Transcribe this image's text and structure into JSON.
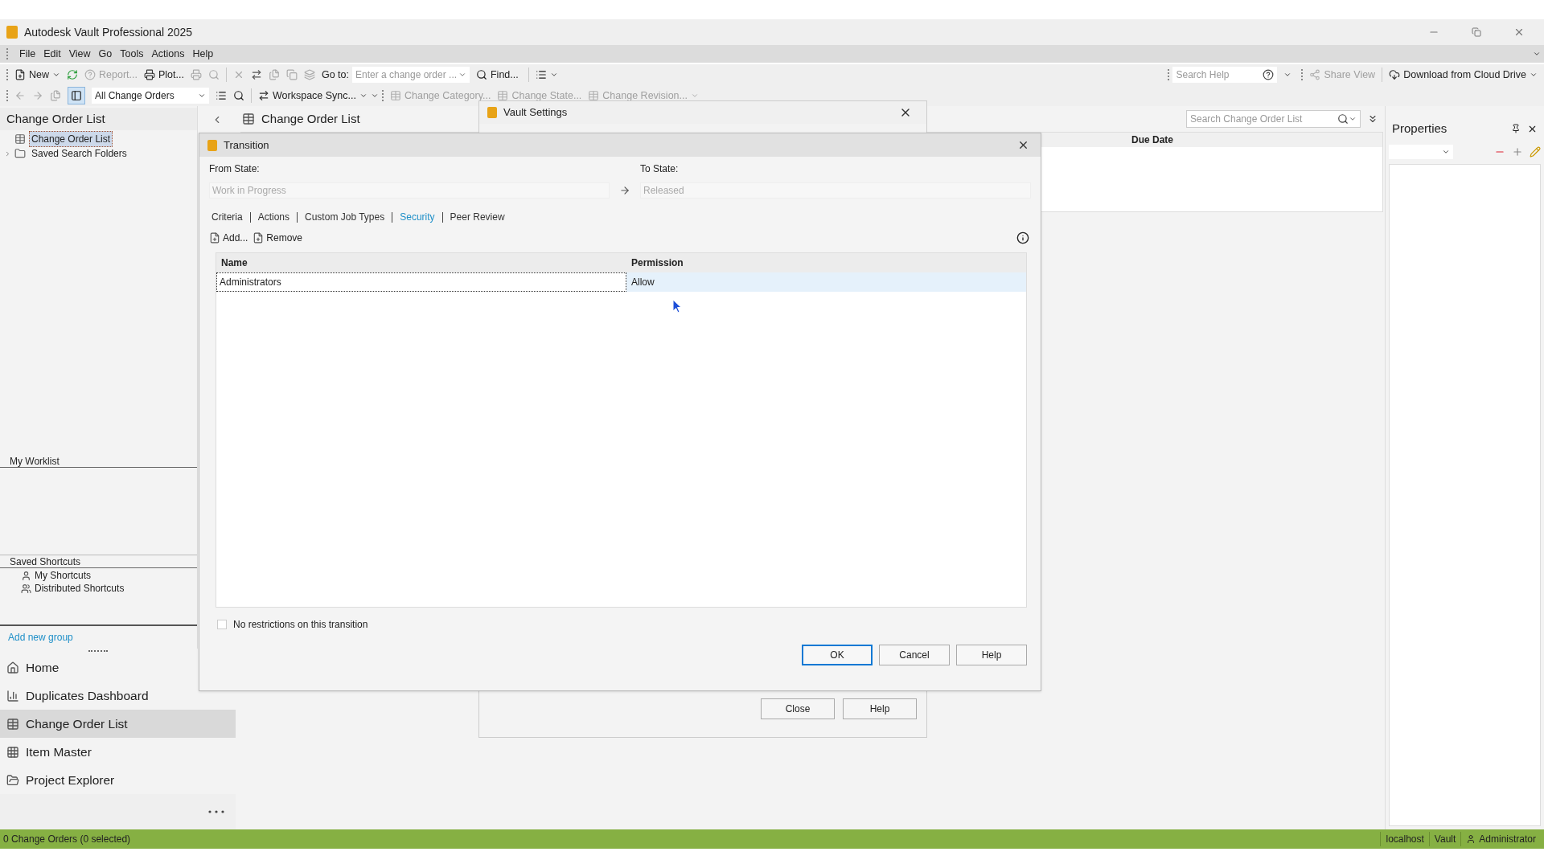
{
  "window": {
    "title": "Autodesk Vault Professional 2025"
  },
  "menu": [
    "File",
    "Edit",
    "View",
    "Go",
    "Tools",
    "Actions",
    "Help"
  ],
  "toolbar_1": {
    "new": {
      "label": "New"
    },
    "report": {
      "label": "Report...",
      "disabled": true
    },
    "plot": {
      "label": "Plot...",
      "disabled": false
    },
    "goto_label": "Go to:",
    "goto_field": {
      "placeholder": "Enter a change order ..."
    },
    "find": {
      "label": "Find..."
    },
    "search_help": {
      "placeholder": "Search Help"
    },
    "share_view": {
      "label": "Share View",
      "disabled": true
    },
    "download": {
      "label": "Download from Cloud Drive",
      "disabled": false
    }
  },
  "toolbar_2": {
    "view_select": {
      "value": "All Change Orders"
    },
    "workspace_sync": {
      "label": "Workspace Sync...",
      "disabled": false
    },
    "change_category": {
      "label": "Change Category...",
      "disabled": true
    },
    "change_state": {
      "label": "Change State...",
      "disabled": true
    },
    "change_revision": {
      "label": "Change Revision...",
      "disabled": true
    }
  },
  "navigator": {
    "title": "Change Order List",
    "items": [
      {
        "label": "Change Order List",
        "selected": true,
        "expandable": false
      },
      {
        "label": "Saved Search Folders",
        "selected": false,
        "expandable": true
      }
    ]
  },
  "worklist": {
    "title": "My Worklist"
  },
  "shortcuts": {
    "title": "Saved Shortcuts",
    "items": [
      "My Shortcuts",
      "Distributed Shortcuts"
    ],
    "add_link": "Add new group"
  },
  "nav": [
    {
      "label": "Home",
      "selected": false
    },
    {
      "label": "Duplicates Dashboard",
      "selected": false
    },
    {
      "label": "Change Order List",
      "selected": true
    },
    {
      "label": "Item Master",
      "selected": false
    },
    {
      "label": "Project Explorer",
      "selected": false
    }
  ],
  "center": {
    "title": "Change Order List",
    "search": {
      "placeholder": "Search Change Order List"
    },
    "columns": [
      "Due Date"
    ]
  },
  "properties": {
    "title": "Properties"
  },
  "vault_settings": {
    "title": "Vault Settings",
    "buttons": [
      "Close",
      "Help"
    ]
  },
  "transition": {
    "title": "Transition",
    "from_label": "From State:",
    "from_value": "Work in Progress",
    "to_label": "To State:",
    "to_value": "Released",
    "tabs": [
      {
        "label": "Criteria",
        "selected": false
      },
      {
        "label": "Actions",
        "selected": false
      },
      {
        "label": "Custom Job Types",
        "selected": false
      },
      {
        "label": "Security",
        "selected": true
      },
      {
        "label": "Peer Review",
        "selected": false
      }
    ],
    "actions": [
      "Add...",
      "Remove"
    ],
    "columns": [
      "Name",
      "Permission"
    ],
    "rows": [
      {
        "name": "Administrators",
        "permission": "Allow",
        "selected": true
      }
    ],
    "no_restrictions": {
      "label": "No restrictions on this transition",
      "checked": false
    },
    "buttons": [
      {
        "label": "OK",
        "default": true
      },
      {
        "label": "Cancel",
        "default": false
      },
      {
        "label": "Help",
        "default": false
      }
    ]
  },
  "status_bar": {
    "text": "0 Change Orders (0 selected)",
    "right": [
      "localhost",
      "Vault",
      "Administrator"
    ]
  }
}
